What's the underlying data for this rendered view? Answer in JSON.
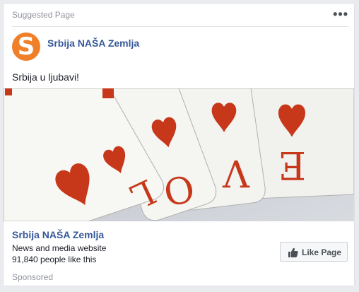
{
  "header": {
    "label": "Suggested Page",
    "more_icon": "more-dots-icon",
    "more_text": "•••"
  },
  "page": {
    "name": "Srbija NAŠA Zemlja",
    "avatar_letter": "S",
    "avatar_color": "#f07f2a"
  },
  "post": {
    "text": "Srbija u ljubavi!"
  },
  "image": {
    "cards": [
      "L",
      "O",
      "V",
      "E"
    ],
    "suit_color": "#c7381b"
  },
  "footer": {
    "name": "Srbija NAŠA Zemlja",
    "category": "News and media website",
    "likes": "91,840 people like this",
    "sponsored": "Sponsored"
  },
  "like_button": {
    "label": "Like Page",
    "icon": "thumbs-up-icon"
  },
  "colors": {
    "link": "#365899",
    "muted": "#90949c",
    "background": "#e9ebee"
  }
}
